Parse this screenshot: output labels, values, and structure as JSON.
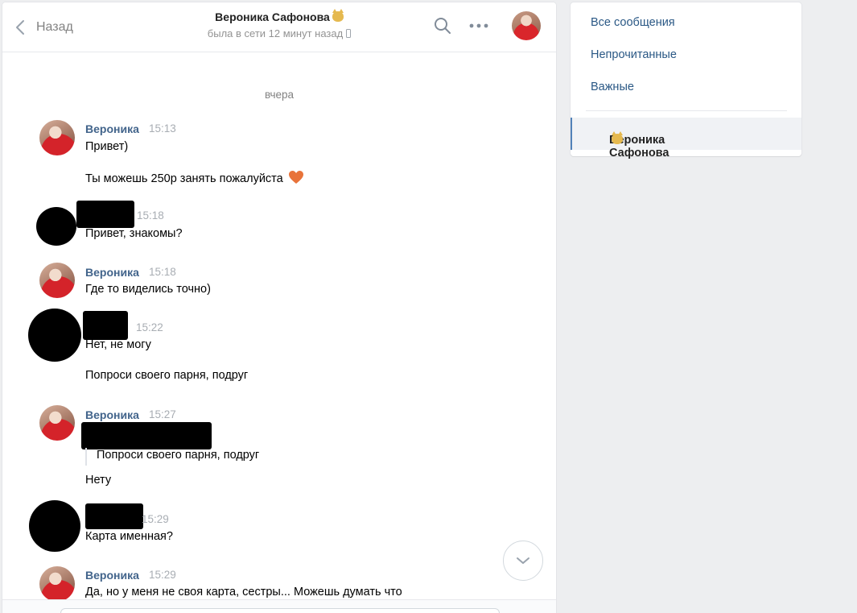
{
  "header": {
    "back_label": "Назад",
    "peer_name": "Вероника Сафонова",
    "peer_status": "была в сети 12 минут назад"
  },
  "chat": {
    "date_separator": "вчера",
    "messages": [
      {
        "author": "Вероника",
        "time": "15:13",
        "lines": [
          "Привет)",
          "Ты можешь 250р занять пожалуйста"
        ]
      },
      {
        "author": "",
        "time": "15:18",
        "lines": [
          "Привет, знакомы?"
        ]
      },
      {
        "author": "Вероника",
        "time": "15:18",
        "lines": [
          "Где то виделись точно)"
        ]
      },
      {
        "author": "",
        "time": "15:22",
        "lines": [
          "Нет, не могу",
          "Попроси своего парня, подруг"
        ]
      },
      {
        "author": "Вероника",
        "time": "15:27",
        "quote": "Попроси своего парня, подруг",
        "lines": [
          "Нету"
        ]
      },
      {
        "author": "",
        "time": "15:29",
        "lines": [
          "Карта именная?"
        ]
      },
      {
        "author": "Вероника",
        "time": "15:29",
        "lines": [
          "Да, но у меня не своя карта, сестры... Можешь думать что"
        ]
      }
    ]
  },
  "sidebar": {
    "items": [
      "Все сообщения",
      "Непрочитанные",
      "Важные"
    ],
    "active_conversation": "Вероника Сафонова"
  },
  "colors": {
    "accent": "#5181b8",
    "author": "#42648b",
    "link": "#2a5885",
    "background": "#edeef0"
  },
  "icons": [
    "chevron-left-icon",
    "search-icon",
    "more-icon",
    "phone-icon",
    "heart-emoji-icon",
    "cat-emoji-icon",
    "chevron-down-icon"
  ]
}
